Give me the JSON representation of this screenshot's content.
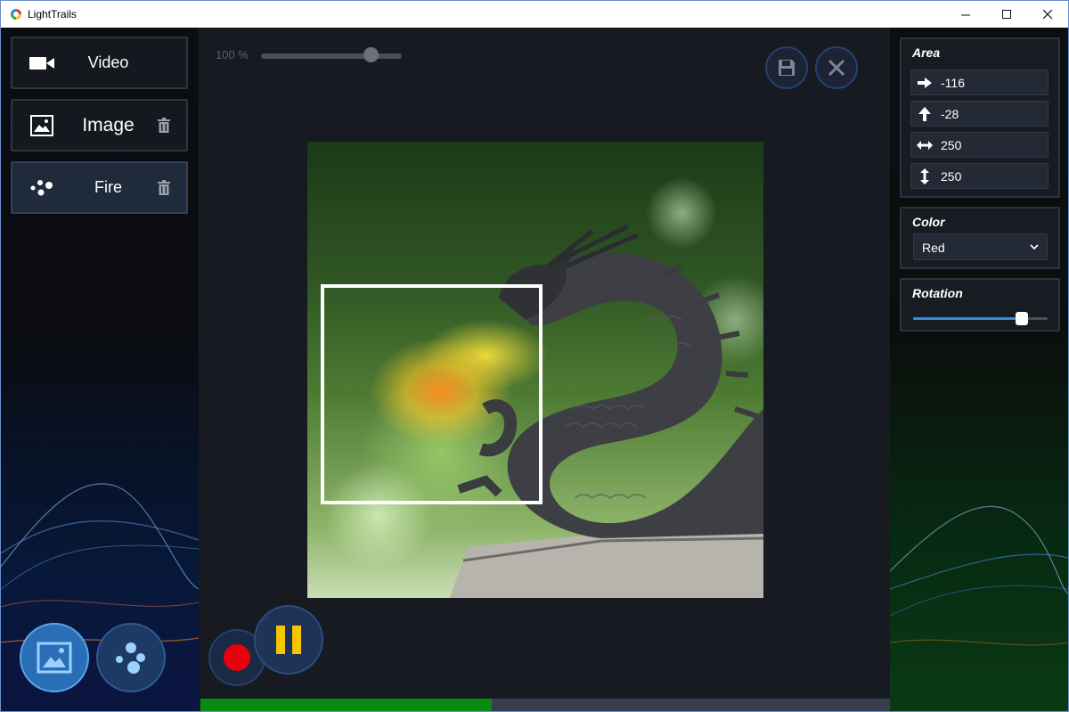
{
  "window": {
    "title": "LightTrails"
  },
  "sources": [
    {
      "label": "Video",
      "icon": "video-camera-icon",
      "deletable": false,
      "active": false
    },
    {
      "label": "Image",
      "icon": "image-icon",
      "deletable": true,
      "active": false
    },
    {
      "label": "Fire",
      "icon": "particles-icon",
      "deletable": true,
      "active": true
    }
  ],
  "zoom": {
    "label": "100 %",
    "level": 0.78
  },
  "progress": {
    "fraction": 0.422
  },
  "area": {
    "title": "Area",
    "x": "-116",
    "y": "-28",
    "width": "250",
    "height": "250"
  },
  "color": {
    "title": "Color",
    "selected": "Red"
  },
  "rotation": {
    "title": "Rotation",
    "value": 0.81
  },
  "colors": {
    "accent": "#2f8de4",
    "record": "#e8000b",
    "pause": "#f7c600",
    "progress": "#0a8a10"
  }
}
